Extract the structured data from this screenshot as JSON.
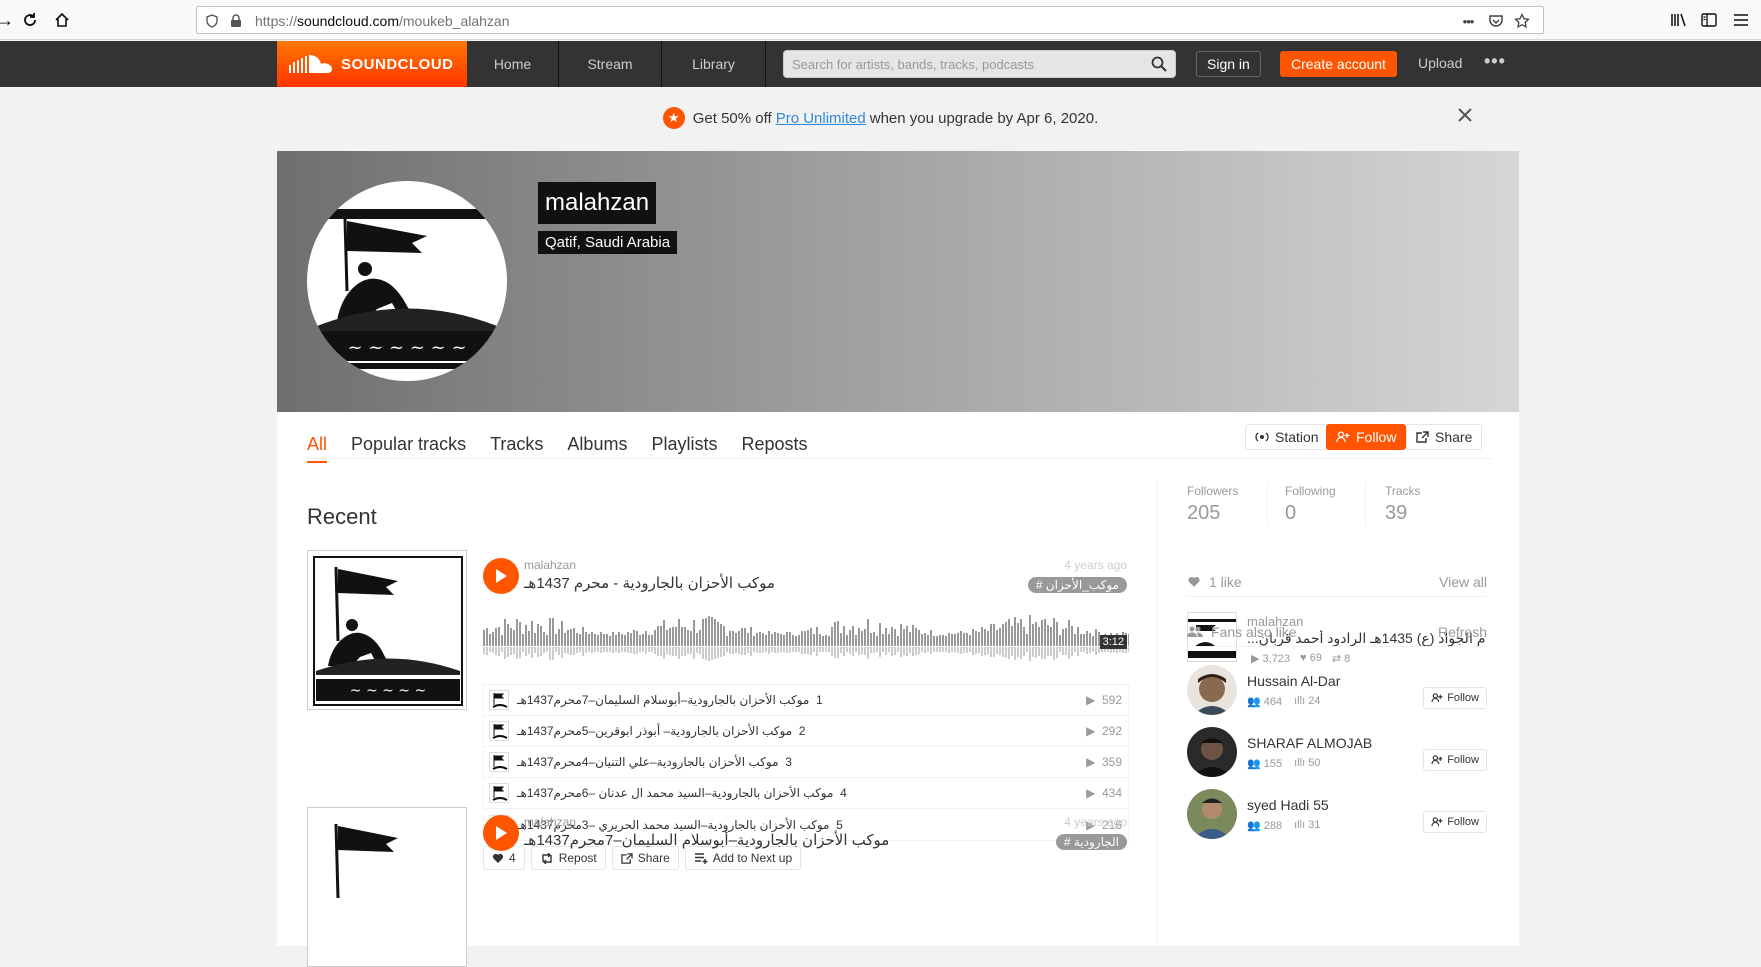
{
  "browser": {
    "url_prefix": "https://",
    "url_domain": "soundcloud.com",
    "url_path": "/moukeb_alahzan",
    "url_dots": "•••"
  },
  "header": {
    "logo_text": "SOUNDCLOUD",
    "nav": [
      "Home",
      "Stream",
      "Library"
    ],
    "search_placeholder": "Search for artists, bands, tracks, podcasts",
    "signin": "Sign in",
    "create": "Create account",
    "upload": "Upload",
    "more": "•••",
    "accent": "#ff5500"
  },
  "promo": {
    "text_before": "Get 50% off",
    "link": "Pro Unlimited",
    "text_after": "when you upgrade by Apr 6, 2020."
  },
  "profile": {
    "name": "malahzan",
    "location": "Qatif, Saudi Arabia"
  },
  "tabs": [
    "All",
    "Popular tracks",
    "Tracks",
    "Albums",
    "Playlists",
    "Reposts"
  ],
  "actions": {
    "station": "Station",
    "follow": "Follow",
    "share": "Share"
  },
  "recent_heading": "Recent",
  "tracks": [
    {
      "user": "malahzan",
      "title": "موكب الأحزان بالجارودية - محرم 1437هـ",
      "date": "4 years ago",
      "tag": "# موكب_الأحزان",
      "duration": "3:12",
      "subtracks": [
        {
          "num": "1",
          "title": "موكب الأحزان بالجارودية–أبوسلام السليمان–7محرم1437هـ",
          "plays": "592"
        },
        {
          "num": "2",
          "title": "موكب الأحزان بالجارودية– أبوذر ابوقرين–5محرم1437هـ",
          "plays": "292"
        },
        {
          "num": "3",
          "title": "موكب الأحزان بالجارودية–علي التنيان–4محرم1437هـ",
          "plays": "359"
        },
        {
          "num": "4",
          "title": "موكب الأحزان بالجارودية–السيد محمد ال عدنان –6محرم1437هـ",
          "plays": "434"
        },
        {
          "num": "5",
          "title": "موكب الأحزان بالجارودية–السيد محمد الحريري –3محرم1437هـ",
          "plays": "216"
        }
      ],
      "likes": "4",
      "repost": "Repost",
      "share": "Share",
      "next_up": "Add to Next up"
    },
    {
      "user": "malahzan",
      "title": "موكب الأحزان بالجارودية–أبوسلام السليمان–7محرم1437هـ",
      "date": "4 years ago",
      "tag": "# الجارودية"
    }
  ],
  "stats": [
    {
      "label": "Followers",
      "value": "205"
    },
    {
      "label": "Following",
      "value": "0"
    },
    {
      "label": "Tracks",
      "value": "39"
    }
  ],
  "likes_section": {
    "heading": "1 like",
    "view_all": "View all",
    "item": {
      "user": "malahzan",
      "title": "...م الجواد (ع) 1435هـ الرادود أحمد قربان",
      "plays": "3,723",
      "likes": "69",
      "reposts": "8"
    }
  },
  "fans_section": {
    "heading": "Fans also like",
    "refresh": "Refresh",
    "follow_label": "Follow",
    "fans": [
      {
        "name": "Hussain Al-Dar",
        "followers": "464",
        "tracks": "24"
      },
      {
        "name": "SHARAF ALMOJAB",
        "followers": "155",
        "tracks": "50"
      },
      {
        "name": "syed Hadi 55",
        "followers": "288",
        "tracks": "31"
      }
    ]
  }
}
